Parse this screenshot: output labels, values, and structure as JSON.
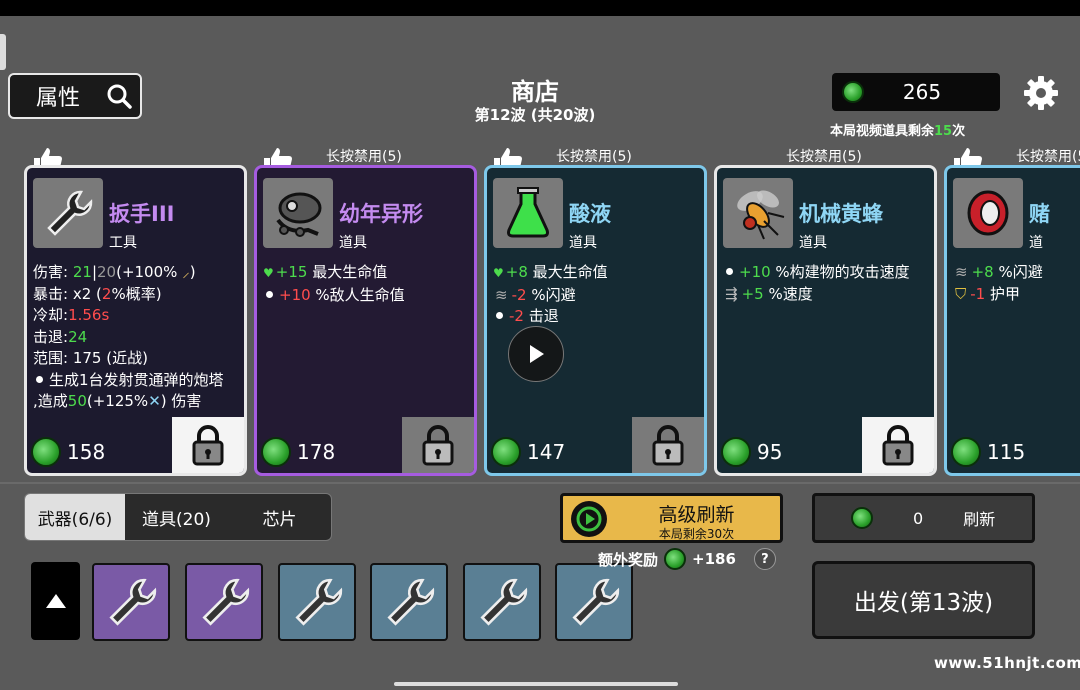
{
  "header": {
    "attr_label": "属性",
    "title": "商店",
    "wave": "第12波 (共20波)",
    "coins": "265",
    "video_prefix": "本局视频道具剩余",
    "video_count": "15",
    "video_suffix": "次"
  },
  "ban_label": "长按禁用(5)",
  "cards": [
    {
      "name": "扳手III",
      "type": "工具",
      "price": "158",
      "stats": {
        "dmg_label": "伤害:",
        "dmg_a": "21",
        "dmg_sep": "|",
        "dmg_b": "20",
        "dmg_pct": "(+100%",
        "crit_label": "暴击:",
        "crit_a": "x2 (",
        "crit_b": "2",
        "crit_c": "%概率)",
        "cd_label": "冷却:",
        "cd_val": "1.56s",
        "kb_label": "击退:",
        "kb_val": "24",
        "range": "范围: 175 (近战)",
        "desc1": "生成1台发射贯通弹的炮塔",
        "desc2a": ",造成",
        "desc2b": "50",
        "desc2c": "(+125%",
        "desc2d": ") 伤害"
      }
    },
    {
      "name": "幼年异形",
      "type": "道具",
      "price": "178",
      "lines": [
        {
          "val": "+15",
          "text": " 最大生命值"
        },
        {
          "val": "+10",
          "text": " %敌人生命值"
        }
      ]
    },
    {
      "name": "酸液",
      "type": "道具",
      "price": "147",
      "lines": [
        {
          "val": "+8",
          "text": " 最大生命值"
        },
        {
          "val": "-2",
          "text": " %闪避"
        },
        {
          "val": "-2",
          "text": " 击退"
        }
      ]
    },
    {
      "name": "机械黄蜂",
      "type": "道具",
      "price": "95",
      "lines": [
        {
          "val": "+10",
          "text": " %构建物的攻击速度"
        },
        {
          "val": "+5",
          "text": " %速度"
        }
      ]
    },
    {
      "name": "赌",
      "type": "道",
      "price": "115",
      "lines": [
        {
          "val": "+8",
          "text": " %闪避"
        },
        {
          "val": "-1",
          "text": " 护甲"
        }
      ]
    }
  ],
  "tabs": {
    "weapons": "武器(6/6)",
    "items": "道具(20)",
    "chips": "芯片"
  },
  "advanced_refresh": {
    "title": "高级刷新",
    "sub": "本局剩余30次"
  },
  "extra": {
    "label": "额外奖励",
    "value": "+186",
    "help": "?"
  },
  "refresh": {
    "cost": "0",
    "label": "刷新"
  },
  "go_label": "出发(第13波)",
  "watermark": "www.51hnjt.com",
  "colors": {
    "coin": "#4ddc4d",
    "positive": "#4ddc4d",
    "negative": "#ff4d4d",
    "purple": "#a65ce0",
    "blue": "#7ec8ea",
    "gold": "#e8b84a"
  }
}
